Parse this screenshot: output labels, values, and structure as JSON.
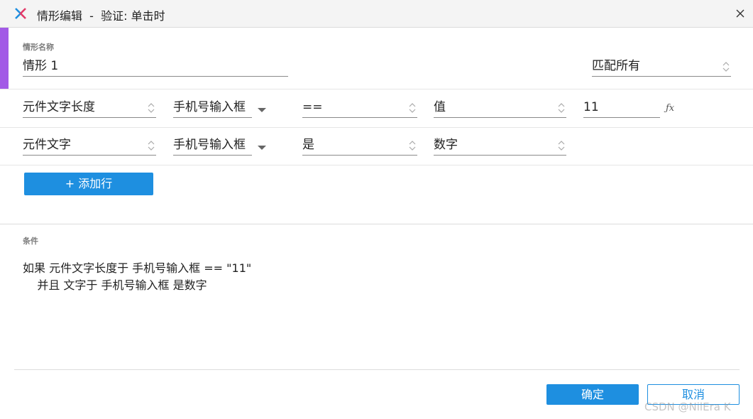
{
  "window": {
    "title": "情形编辑  -  验证: 单击时"
  },
  "case_name": {
    "label": "情形名称",
    "value": "情形 1",
    "match_mode": "匹配所有"
  },
  "rows": [
    {
      "subject": "元件文字长度",
      "target": "手机号输入框",
      "operator": "==",
      "value_type": "值",
      "value": "11"
    },
    {
      "subject": "元件文字",
      "target": "手机号输入框",
      "operator": "是",
      "value_type": "数字"
    }
  ],
  "add_row_label": "+ 添加行",
  "conditions": {
    "label": "条件",
    "line1": "如果 元件文字长度于 手机号输入框 == \"11\"",
    "line2": "    并且 文字于 手机号输入框 是数字"
  },
  "buttons": {
    "ok": "确定",
    "cancel": "取消"
  },
  "watermark": "CSDN @NilEra K",
  "colors": {
    "accent": "#a25ae6",
    "primary": "#1e8fe0"
  },
  "icons": {
    "fx": "ƒx"
  }
}
